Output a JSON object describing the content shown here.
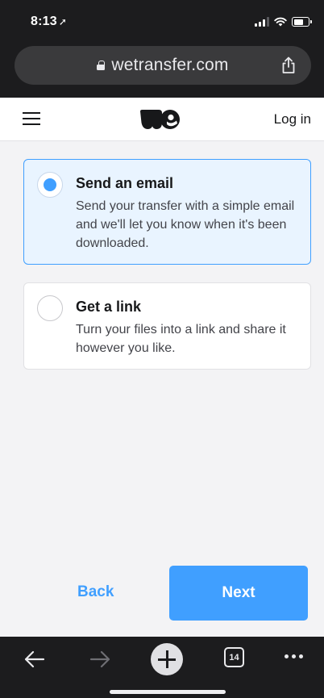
{
  "status_bar": {
    "time": "8:13",
    "location_icon": "location-arrow-icon"
  },
  "browser": {
    "url": "wetransfer.com",
    "tab_count": "14"
  },
  "header": {
    "logo_icon": "wetransfer-we-logo",
    "login_label": "Log in"
  },
  "options": [
    {
      "title": "Send an email",
      "description": "Send your transfer with a simple email and we'll let you know when it's been downloaded.",
      "selected": true
    },
    {
      "title": "Get a link",
      "description": "Turn your files into a link and share it however you like.",
      "selected": false
    }
  ],
  "actions": {
    "back_label": "Back",
    "next_label": "Next"
  },
  "colors": {
    "accent": "#409fff",
    "selected_bg": "#e9f4ff",
    "chrome_bg": "#1c1c1e"
  }
}
